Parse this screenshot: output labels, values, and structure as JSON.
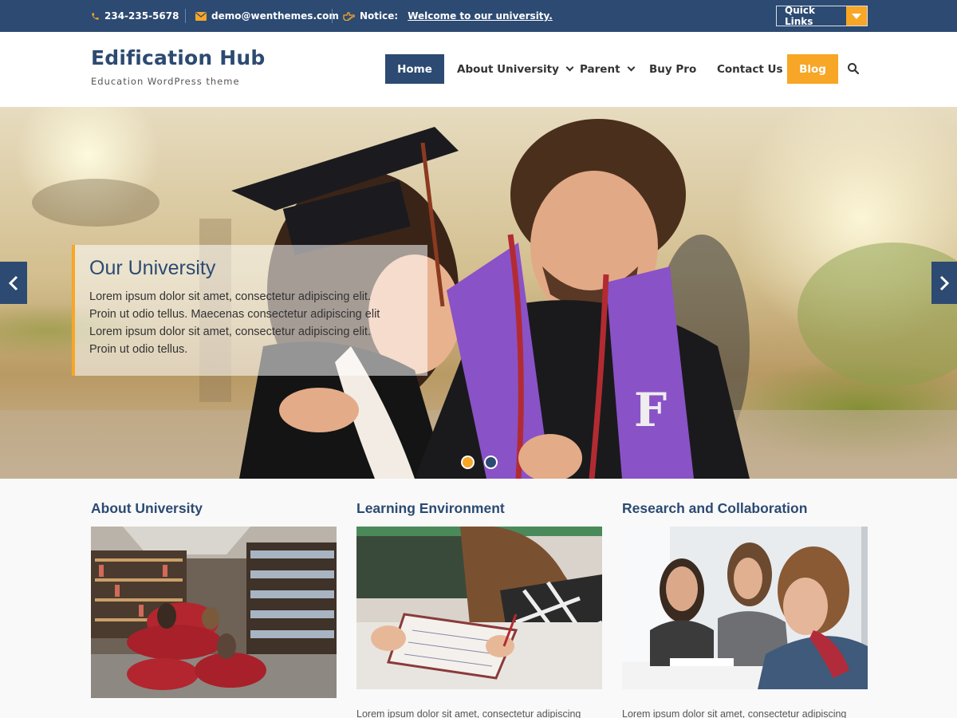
{
  "topbar": {
    "phone": "234-235-5678",
    "email": "demo@wenthemes.com",
    "notice_label": "Notice:",
    "notice_link": "Welcome to our university.",
    "quick_links": "Quick Links"
  },
  "header": {
    "site_title": "Edification Hub",
    "tagline": "Education WordPress theme"
  },
  "nav": {
    "items": [
      {
        "label": "Home",
        "active": true
      },
      {
        "label": "About University",
        "dropdown": true
      },
      {
        "label": "Parent",
        "dropdown": true
      },
      {
        "label": "Buy Pro"
      },
      {
        "label": "Contact Us"
      },
      {
        "label": "Blog",
        "highlight": true
      }
    ]
  },
  "slider": {
    "title": "Our University",
    "text_lines": [
      "Lorem ipsum dolor sit amet, consectetur adipiscing elit.",
      "Proin ut odio tellus. Maecenas consectetur adipiscing elit",
      "Lorem ipsum dolor sit amet, consectetur adipiscing elit.",
      "Proin ut odio tellus."
    ],
    "active_slide": 1,
    "slide_count": 2
  },
  "columns": [
    {
      "title": "About University",
      "image": "library-photo",
      "excerpt": ""
    },
    {
      "title": "Learning Environment",
      "image": "student-writing-photo",
      "excerpt": "Lorem ipsum dolor sit amet, consectetur adipiscing"
    },
    {
      "title": "Research and Collaboration",
      "image": "students-group-photo",
      "excerpt": "Lorem ipsum dolor sit amet, consectetur adipiscing"
    }
  ],
  "colors": {
    "primary": "#2c4a72",
    "accent": "#f7a626"
  },
  "icons": {
    "phone": "phone-icon",
    "email": "envelope-icon",
    "notice": "hand-pointer-icon",
    "search": "search-icon",
    "prev": "chevron-left-icon",
    "next": "chevron-right-icon"
  }
}
